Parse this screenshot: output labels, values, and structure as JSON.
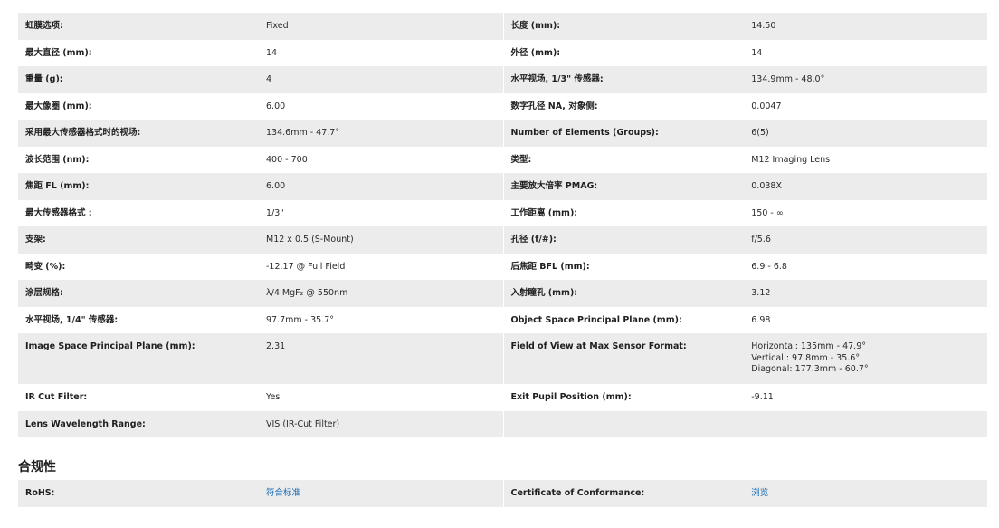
{
  "specs": [
    {
      "l1": "虹膜选项:",
      "v1": "Fixed",
      "l2": "长度 (mm):",
      "v2": "14.50"
    },
    {
      "l1": "最大直径 (mm):",
      "v1": "14",
      "l2": "外径 (mm):",
      "v2": "14"
    },
    {
      "l1": "重量 (g):",
      "v1": "4",
      "l2": "水平视场, 1/3\" 传感器:",
      "v2": "134.9mm - 48.0°"
    },
    {
      "l1": "最大像圈 (mm):",
      "v1": "6.00",
      "l2": "数字孔径 NA, 对象侧:",
      "v2": "0.0047"
    },
    {
      "l1": "采用最大传感器格式时的视场:",
      "v1": "134.6mm - 47.7°",
      "l2": "Number of Elements (Groups):",
      "v2": "6(5)"
    },
    {
      "l1": "波长范围 (nm):",
      "v1": "400 - 700",
      "l2": "类型:",
      "v2": "M12 Imaging Lens"
    },
    {
      "l1": "焦距 FL (mm):",
      "v1": "6.00",
      "l2": "主要放大倍率 PMAG:",
      "v2": "0.038X"
    },
    {
      "l1": "最大传感器格式 :",
      "v1": "1/3\"",
      "l2": "工作距离 (mm):",
      "v2": "150 - ∞"
    },
    {
      "l1": "支架:",
      "v1": "M12 x 0.5 (S-Mount)",
      "l2": "孔径 (f/#):",
      "v2": "f/5.6"
    },
    {
      "l1": "畸变 (%):",
      "v1": "-12.17 @ Full Field",
      "l2": "后焦距 BFL (mm):",
      "v2": "6.9 - 6.8"
    },
    {
      "l1": "涂层规格:",
      "v1": "λ/4 MgF₂ @ 550nm",
      "l2": "入射瞳孔 (mm):",
      "v2": "3.12"
    },
    {
      "l1": "水平视场, 1/4\" 传感器:",
      "v1": "97.7mm - 35.7°",
      "l2": "Object Space Principal Plane (mm):",
      "v2": "6.98"
    }
  ],
  "tall_row": {
    "l1": "Image Space Principal Plane (mm):",
    "v1": "2.31",
    "l2": "Field of View at Max Sensor Format:",
    "v2_lines": [
      "Horizontal: 135mm - 47.9°",
      "Vertical : 97.8mm - 35.6°",
      "Diagonal: 177.3mm - 60.7°"
    ]
  },
  "tail_rows": [
    {
      "l1": "IR Cut Filter:",
      "v1": "Yes",
      "l2": "Exit Pupil Position (mm):",
      "v2": "-9.11"
    },
    {
      "l1": "Lens Wavelength Range:",
      "v1": "VIS (IR-Cut Filter)",
      "l2": "",
      "v2": ""
    }
  ],
  "compliance": {
    "title": "合规性",
    "rohs_label": "RoHS:",
    "rohs_link": "符合标准",
    "coc_label": "Certificate of Conformance:",
    "coc_link": "浏览"
  }
}
